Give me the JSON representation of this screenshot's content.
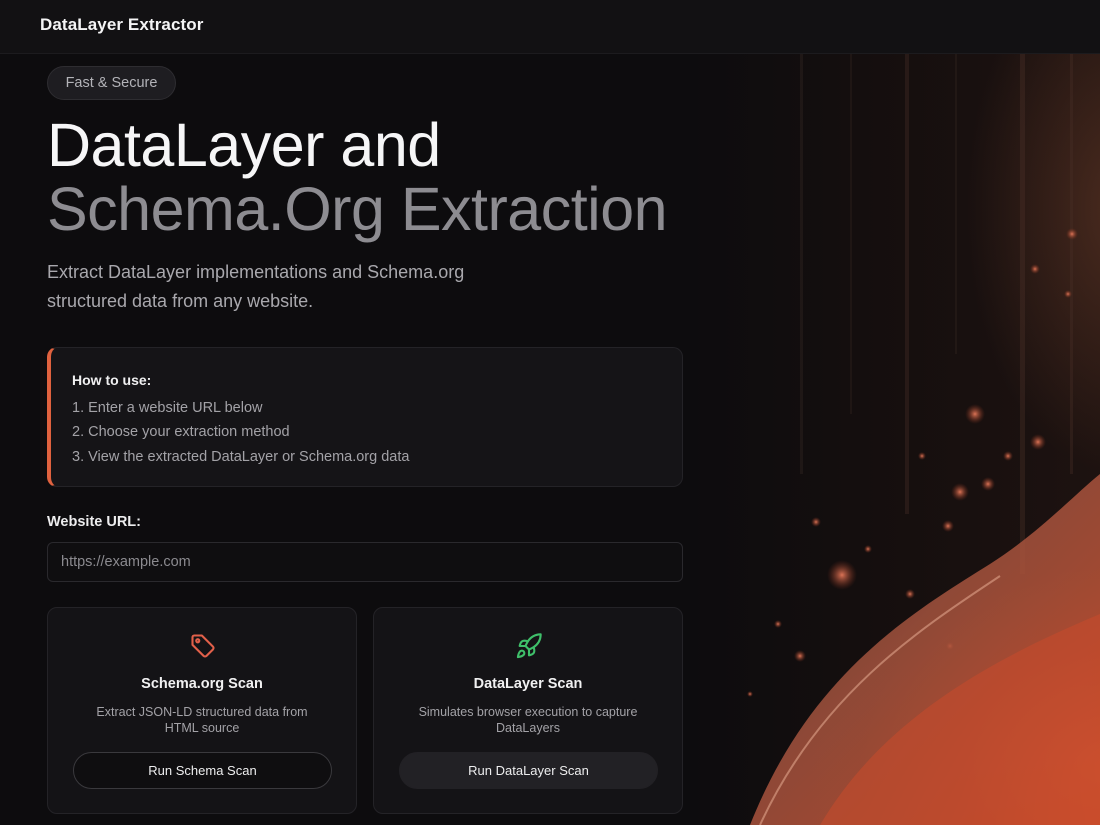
{
  "app": {
    "title": "DataLayer Extractor"
  },
  "hero": {
    "badge": "Fast & Secure",
    "title_line1": "DataLayer and",
    "title_line2": "Schema.Org Extraction",
    "subtitle_line1": "Extract DataLayer implementations and Schema.org",
    "subtitle_line2": "structured data from any website."
  },
  "how_to": {
    "title": "How to use:",
    "steps": [
      "1. Enter a website URL below",
      "2. Choose your extraction method",
      "3. View the extracted DataLayer or Schema.org data"
    ]
  },
  "url_field": {
    "label": "Website URL:",
    "placeholder": "https://example.com",
    "value": ""
  },
  "cards": [
    {
      "icon": "tag-icon",
      "title": "Schema.org Scan",
      "desc_line1": "Extract JSON-LD structured data from",
      "desc_line2": "HTML source",
      "button": "Run Schema Scan"
    },
    {
      "icon": "rocket-icon",
      "title": "DataLayer Scan",
      "desc_line1": "Simulates browser execution to capture",
      "desc_line2": "DataLayers",
      "button": "Run DataLayer Scan"
    }
  ],
  "colors": {
    "accent": "#e0623f",
    "tag_icon": "#e2604a",
    "rocket_icon": "#3fbf6a",
    "background": "#0d0c0e"
  }
}
